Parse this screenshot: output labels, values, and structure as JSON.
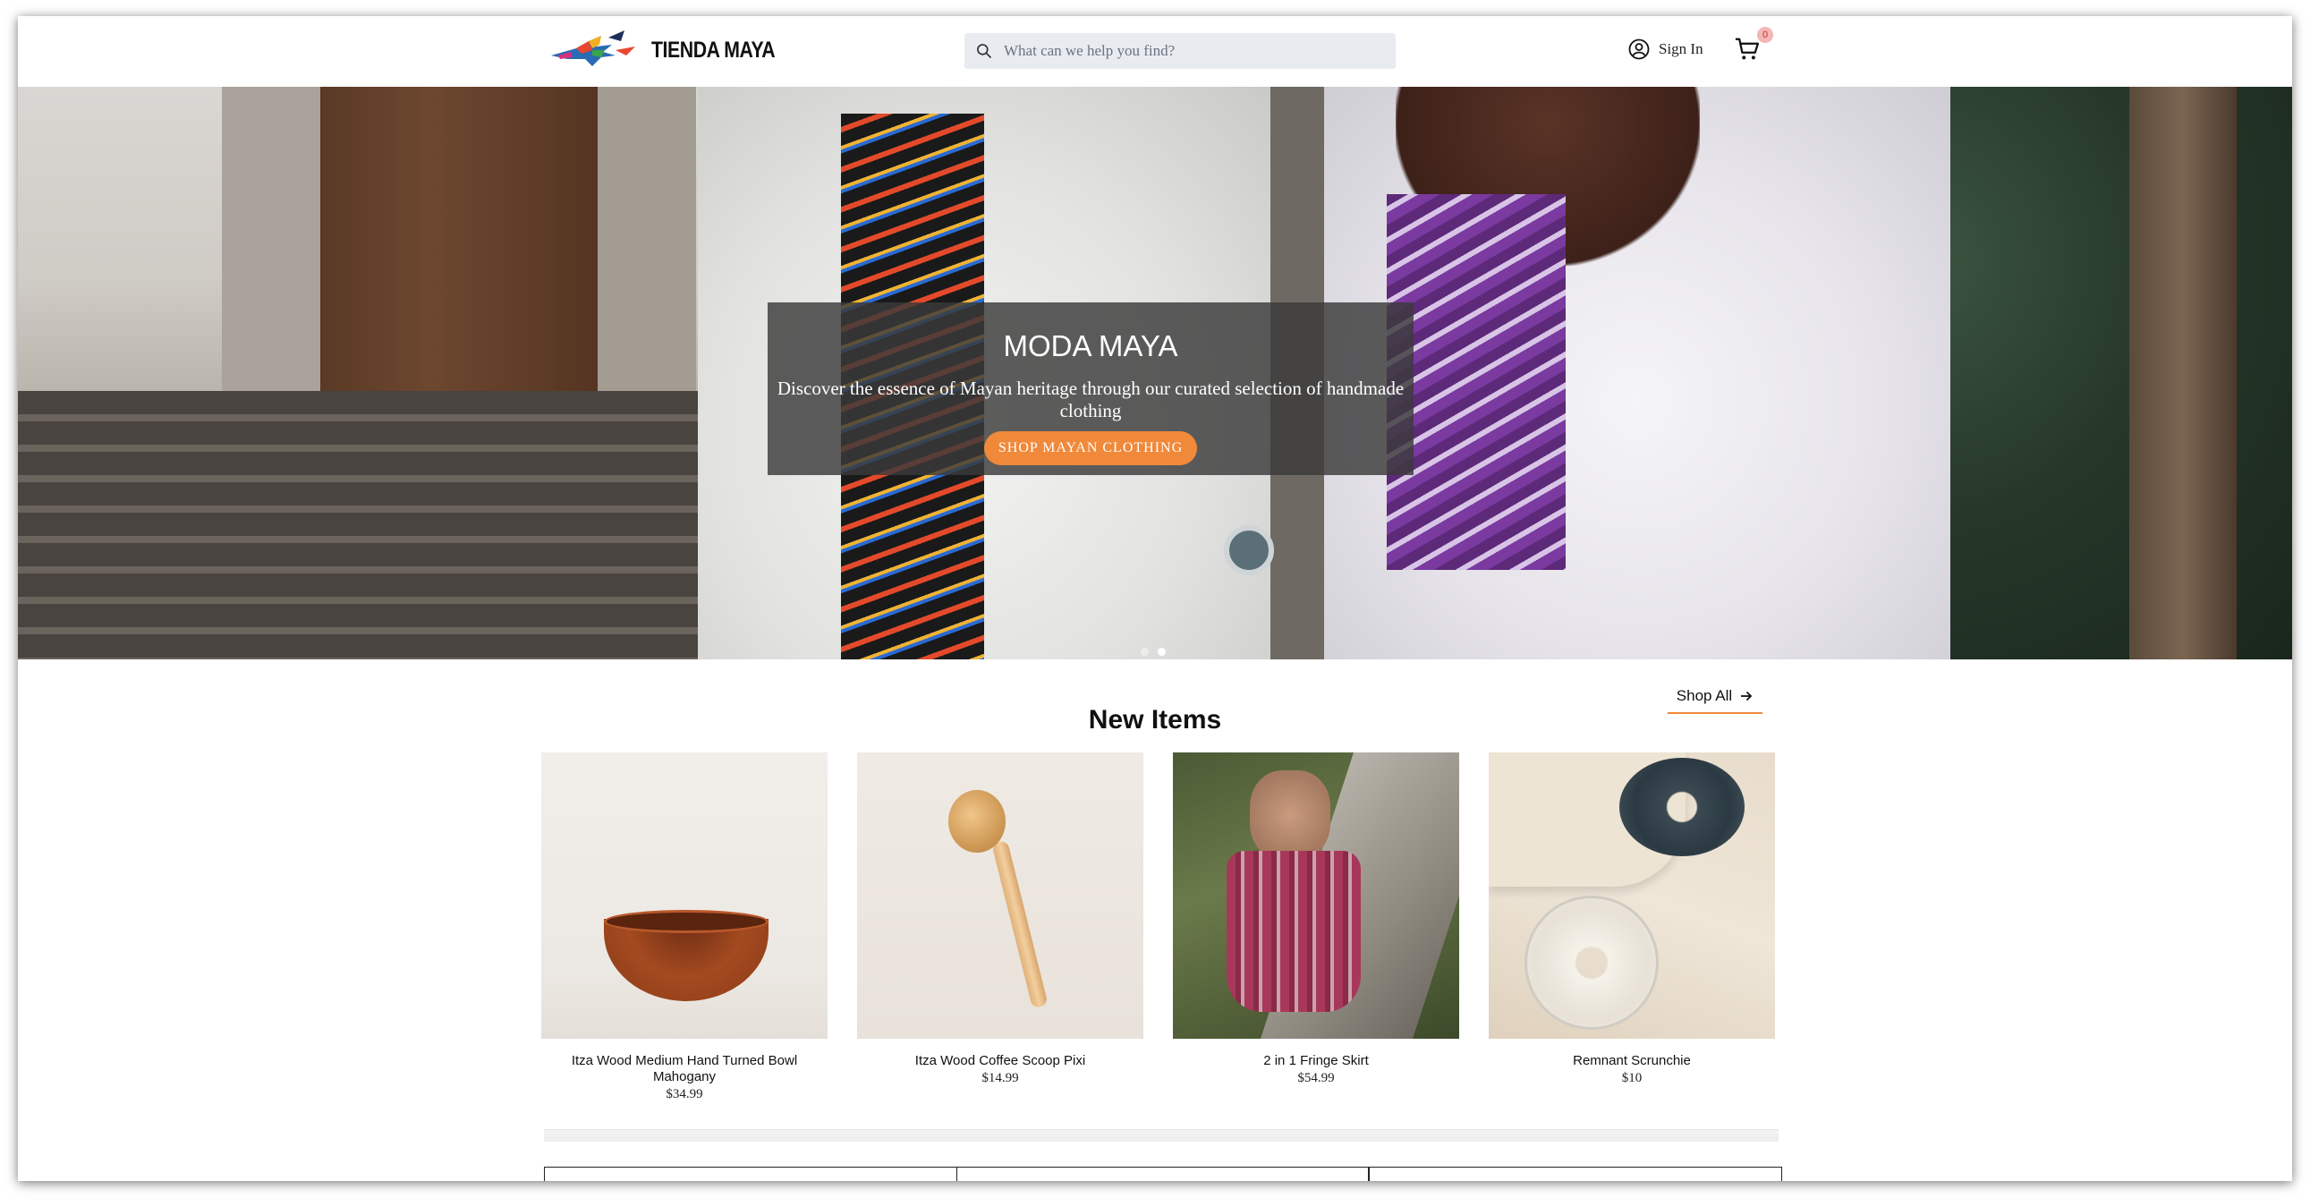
{
  "brand": {
    "name": "TIENDA MAYA",
    "logo_icon": "quetzal-bird-icon"
  },
  "search": {
    "placeholder": "What can we help you find?"
  },
  "account": {
    "signin_label": "Sign In"
  },
  "cart": {
    "count": "0"
  },
  "hero": {
    "title": "MODA MAYA",
    "subtitle": "Discover the essence of Mayan heritage through our curated selection of handmade clothing",
    "cta": "SHOP MAYAN CLOTHING",
    "slides": 2,
    "active_slide": 2
  },
  "new_items": {
    "title": "New Items",
    "shop_all": "Shop All",
    "products": [
      {
        "name": "Itza Wood Medium Hand Turned Bowl Mahogany",
        "price": "$34.99"
      },
      {
        "name": "Itza Wood Coffee Scoop Pixi",
        "price": "$14.99"
      },
      {
        "name": "2 in 1 Fringe Skirt",
        "price": "$54.99"
      },
      {
        "name": "Remnant Scrunchie",
        "price": "$10"
      }
    ]
  },
  "colors": {
    "accent": "#f0893a",
    "hero_overlay": "#3a3a3a",
    "search_bg": "#e8ecf1"
  }
}
